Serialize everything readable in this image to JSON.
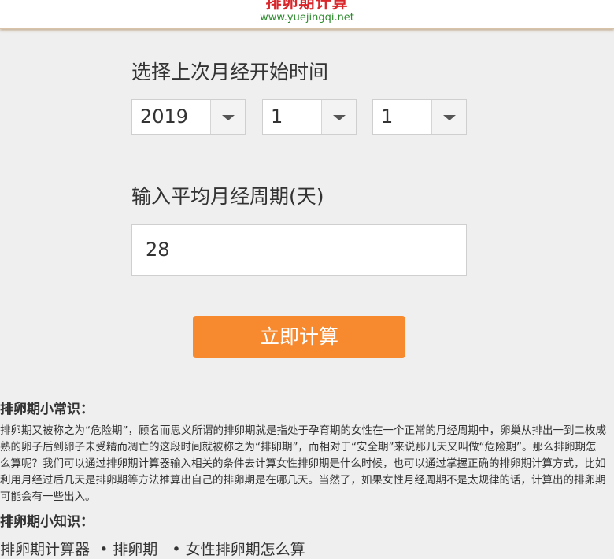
{
  "header": {
    "title": "排卵期计算",
    "url": "www.yuejingqi.net"
  },
  "form": {
    "date_label": "选择上次月经开始时间",
    "year": "2019",
    "month": "1",
    "day": "1",
    "cycle_label": "输入平均月经周期(天)",
    "cycle_value": "28",
    "submit_label": "立即计算"
  },
  "info": {
    "common_title": "排卵期小常识：",
    "common_text": "排卵期又被称之为“危险期”，顾名而思义所谓的排卵期就是指处于孕育期的女性在一个正常的月经周期中，卵巢从排出一到二枚成熟的卵子后到卵子未受精而凋亡的这段时间就被称之为“排卵期”，而相对于“安全期”来说那几天又叫做“危险期”。那么排卵期怎么算呢？我们可以通过排卵期计算器输入相关的条件去计算女性排卵期是什么时候，也可以通过掌握正确的排卵期计算方式，比如利用月经过后几天是排卵期等方法推算出自己的排卵期是在哪几天。当然了，如果女性月经周期不是太规律的话，计算出的排卵期可能会有一些出入。",
    "knowledge_title": "排卵期小知识：",
    "links": [
      "排卵期计算器",
      "排卵期",
      "女性排卵期怎么算"
    ]
  }
}
